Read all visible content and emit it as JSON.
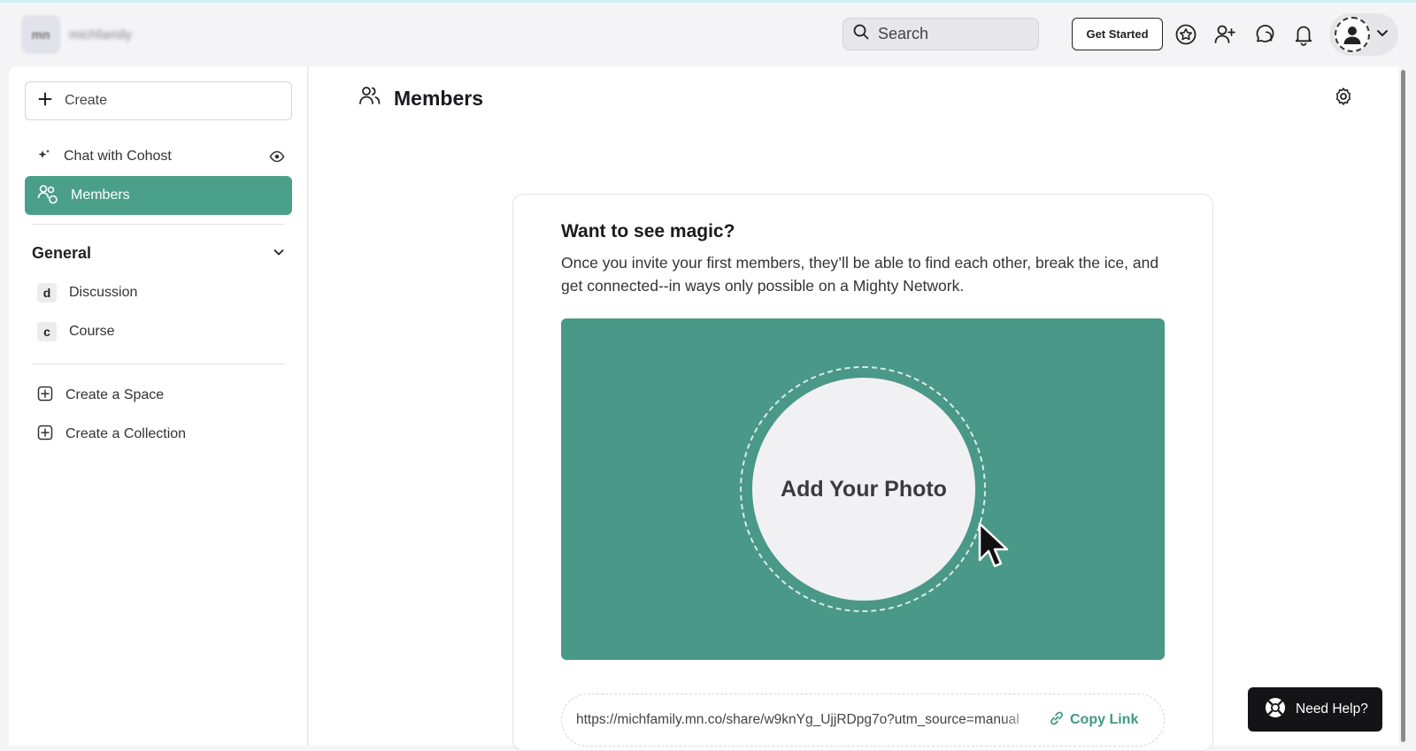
{
  "brand": {
    "logo_text": "mn",
    "name": "michfamily"
  },
  "header": {
    "search_placeholder": "Search",
    "get_started_label": "Get Started",
    "icons": [
      "star-badge-icon",
      "add-person-icon",
      "chat-bubbles-icon",
      "bell-icon",
      "avatar-icon",
      "chevron-down-icon"
    ]
  },
  "sidebar": {
    "create_label": "Create",
    "chat_label": "Chat with Cohost",
    "members_label": "Members",
    "section_title": "General",
    "spaces": [
      {
        "badge": "d",
        "label": "Discussion"
      },
      {
        "badge": "c",
        "label": "Course"
      }
    ],
    "create_space_label": "Create a Space",
    "create_collection_label": "Create a Collection"
  },
  "main": {
    "title": "Members",
    "card": {
      "heading": "Want to see magic?",
      "body": "Once you invite your first members, they’ll be able to find each other, break the ice, and get connected--in ways only possible on a Mighty Network.",
      "photo_label": "Add Your Photo",
      "share_url": "https://michfamily.mn.co/share/w9knYg_UjjRDpg7o?utm_source=manual",
      "copy_label": "Copy Link"
    }
  },
  "help": {
    "label": "Need Help?"
  },
  "colors": {
    "accent": "#4a9f89",
    "banner": "#4a9887",
    "link": "#3f9982",
    "help_bg": "#141416"
  }
}
